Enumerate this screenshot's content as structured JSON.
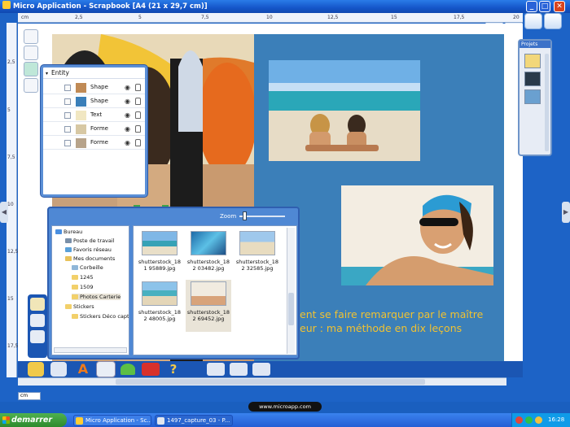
{
  "window": {
    "title": "Micro Application - Scrapbook [A4 (21 x 29,7 cm)]",
    "minimize": "_",
    "maximize": "□",
    "close": "✕"
  },
  "ruler": {
    "unit": "cm",
    "top_ticks": [
      "2,5",
      "5",
      "7,5",
      "10",
      "12,5",
      "15",
      "17,5",
      "20"
    ],
    "left_ticks": [
      "2,5",
      "5",
      "7,5",
      "10",
      "12,5",
      "15",
      "17,5"
    ]
  },
  "right_panel": {
    "title": "Projets"
  },
  "entity_panel": {
    "header": "Entity",
    "rows": [
      {
        "label": "Shape"
      },
      {
        "label": "Shape"
      },
      {
        "label": "Text"
      },
      {
        "label": "Forme"
      },
      {
        "label": "Forme"
      }
    ]
  },
  "browser": {
    "zoom_label": "Zoom",
    "tree": [
      {
        "label": "Bureau"
      },
      {
        "label": "Poste de travail"
      },
      {
        "label": "Favoris réseau"
      },
      {
        "label": "Mes documents"
      },
      {
        "label": "Corbeille"
      },
      {
        "label": "1245"
      },
      {
        "label": "1509"
      },
      {
        "label": "Photos Carterie"
      },
      {
        "label": "Stickers"
      },
      {
        "label": "Stickers Déco capt"
      }
    ],
    "thumbnails": [
      {
        "label": "shutterstock_181 95889.jpg"
      },
      {
        "label": "shutterstock_182 03482.jpg"
      },
      {
        "label": "shutterstock_182 32585.jpg"
      },
      {
        "label": "shutterstock_182 48005.jpg"
      },
      {
        "label": "shutterstock_182 69452.jpg"
      }
    ]
  },
  "page": {
    "caption_line1": "ent se faire remarquer par le maître",
    "caption_line2": "eur : ma méthode en dix leçons"
  },
  "status": {
    "unit_select": "cm",
    "url": "www.microapp.com"
  },
  "taskbar": {
    "start": "demarrer",
    "tasks": [
      "Micro Application - Sc...",
      "1497_capture_03 - P..."
    ],
    "clock": "16:28"
  }
}
